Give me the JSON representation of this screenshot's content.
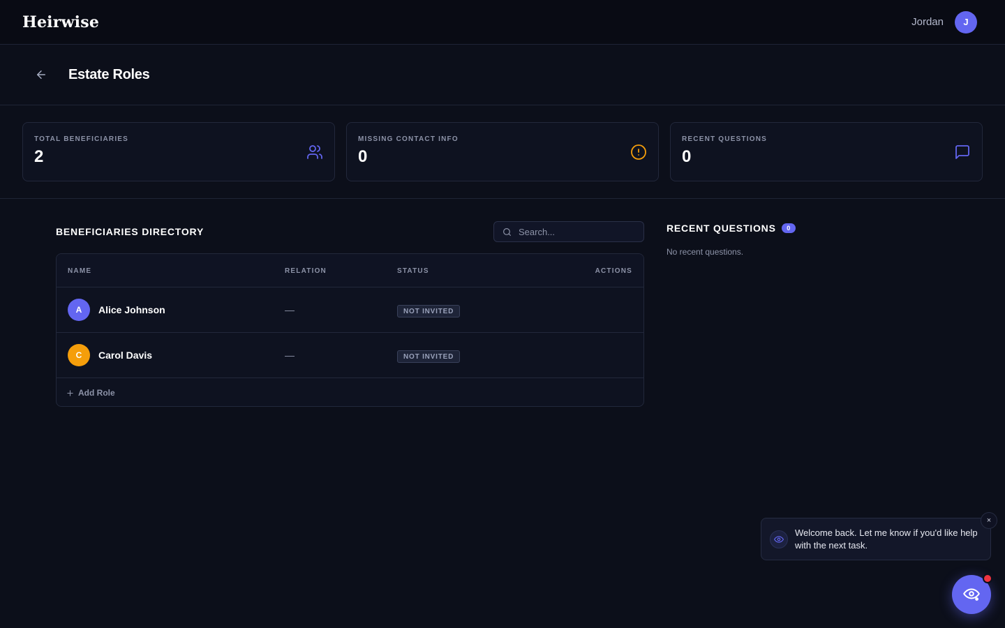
{
  "header": {
    "brand": "Heirwise",
    "user_name": "Jordan",
    "user_initial": "J"
  },
  "page": {
    "title": "Estate Roles"
  },
  "stats": [
    {
      "label": "TOTAL BENEFICIARIES",
      "value": "2",
      "icon": "users-icon",
      "icon_color": "#6366f1"
    },
    {
      "label": "MISSING CONTACT INFO",
      "value": "0",
      "icon": "alert-circle-icon",
      "icon_color": "#f59e0b"
    },
    {
      "label": "RECENT QUESTIONS",
      "value": "0",
      "icon": "message-square-icon",
      "icon_color": "#6366f1"
    }
  ],
  "directory": {
    "title": "BENEFICIARIES DIRECTORY",
    "search_placeholder": "Search...",
    "columns": [
      "NAME",
      "RELATION",
      "STATUS",
      "ACTIONS"
    ],
    "rows": [
      {
        "initial": "A",
        "name": "Alice Johnson",
        "relation": "—",
        "status": "NOT INVITED",
        "avatar_color": "#6366f1"
      },
      {
        "initial": "C",
        "name": "Carol Davis",
        "relation": "—",
        "status": "NOT INVITED",
        "avatar_color": "#f59e0b"
      }
    ],
    "add_label": "Add Role"
  },
  "recent_questions": {
    "title": "RECENT QUESTIONS",
    "count": "0",
    "empty_text": "No recent questions."
  },
  "assistant": {
    "message": "Welcome back. Let me know if you'd like help with the next task.",
    "close_label": "×"
  },
  "colors": {
    "accent": "#6366f1",
    "warning": "#f59e0b",
    "notification": "#ef3340"
  }
}
